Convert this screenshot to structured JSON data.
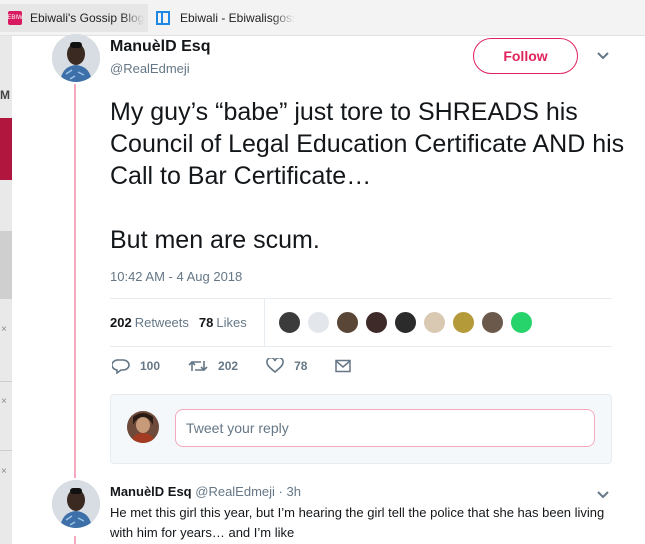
{
  "browser": {
    "tabs": [
      {
        "title": "Ebiwali's Gossip Blog",
        "favicon": "ebiwali-logo-icon",
        "favicon_text": "EBIW"
      },
      {
        "title": "Ebiwali - Ebiwalisgossipblog",
        "favicon": "window-icon"
      }
    ]
  },
  "background_page": {
    "letter": "M",
    "close_mark": "×"
  },
  "tweet": {
    "author_name": "ManuèlD Esq",
    "author_handle": "@RealEdmeji",
    "follow_label": "Follow",
    "menu_icon": "chevron-down-icon",
    "text_line1": "My guy’s “babe” just tore to SHREADS his Council of Legal Education Certificate AND his Call to Bar Certificate…",
    "text_line2": "But men are scum.",
    "timestamp": "10:42 AM - 4 Aug 2018",
    "retweets_count": "202",
    "retweets_label": "Retweets",
    "likes_count": "78",
    "likes_label": "Likes",
    "liker_avatar_colors": [
      "#3b3b3b",
      "#e3e7ec",
      "#5a4636",
      "#3f2a2a",
      "#2b2b2b",
      "#d9c9b3",
      "#b59a3a",
      "#6b5a4b",
      "#27d36b"
    ],
    "actions": {
      "reply_count": "100",
      "retweet_count": "202",
      "like_count": "78"
    },
    "reply_placeholder": "Tweet your reply"
  },
  "reply": {
    "author_name": "ManuèlD Esq",
    "author_handle": "@RealEdmeji",
    "time": "· 3h",
    "text": "He met this girl this year, but I’m hearing the girl tell the police that she has been living with him for years… and I’m like"
  },
  "colors": {
    "accent": "#e0245e",
    "thread_line": "#f4a9be",
    "secondary_text": "#657786"
  }
}
